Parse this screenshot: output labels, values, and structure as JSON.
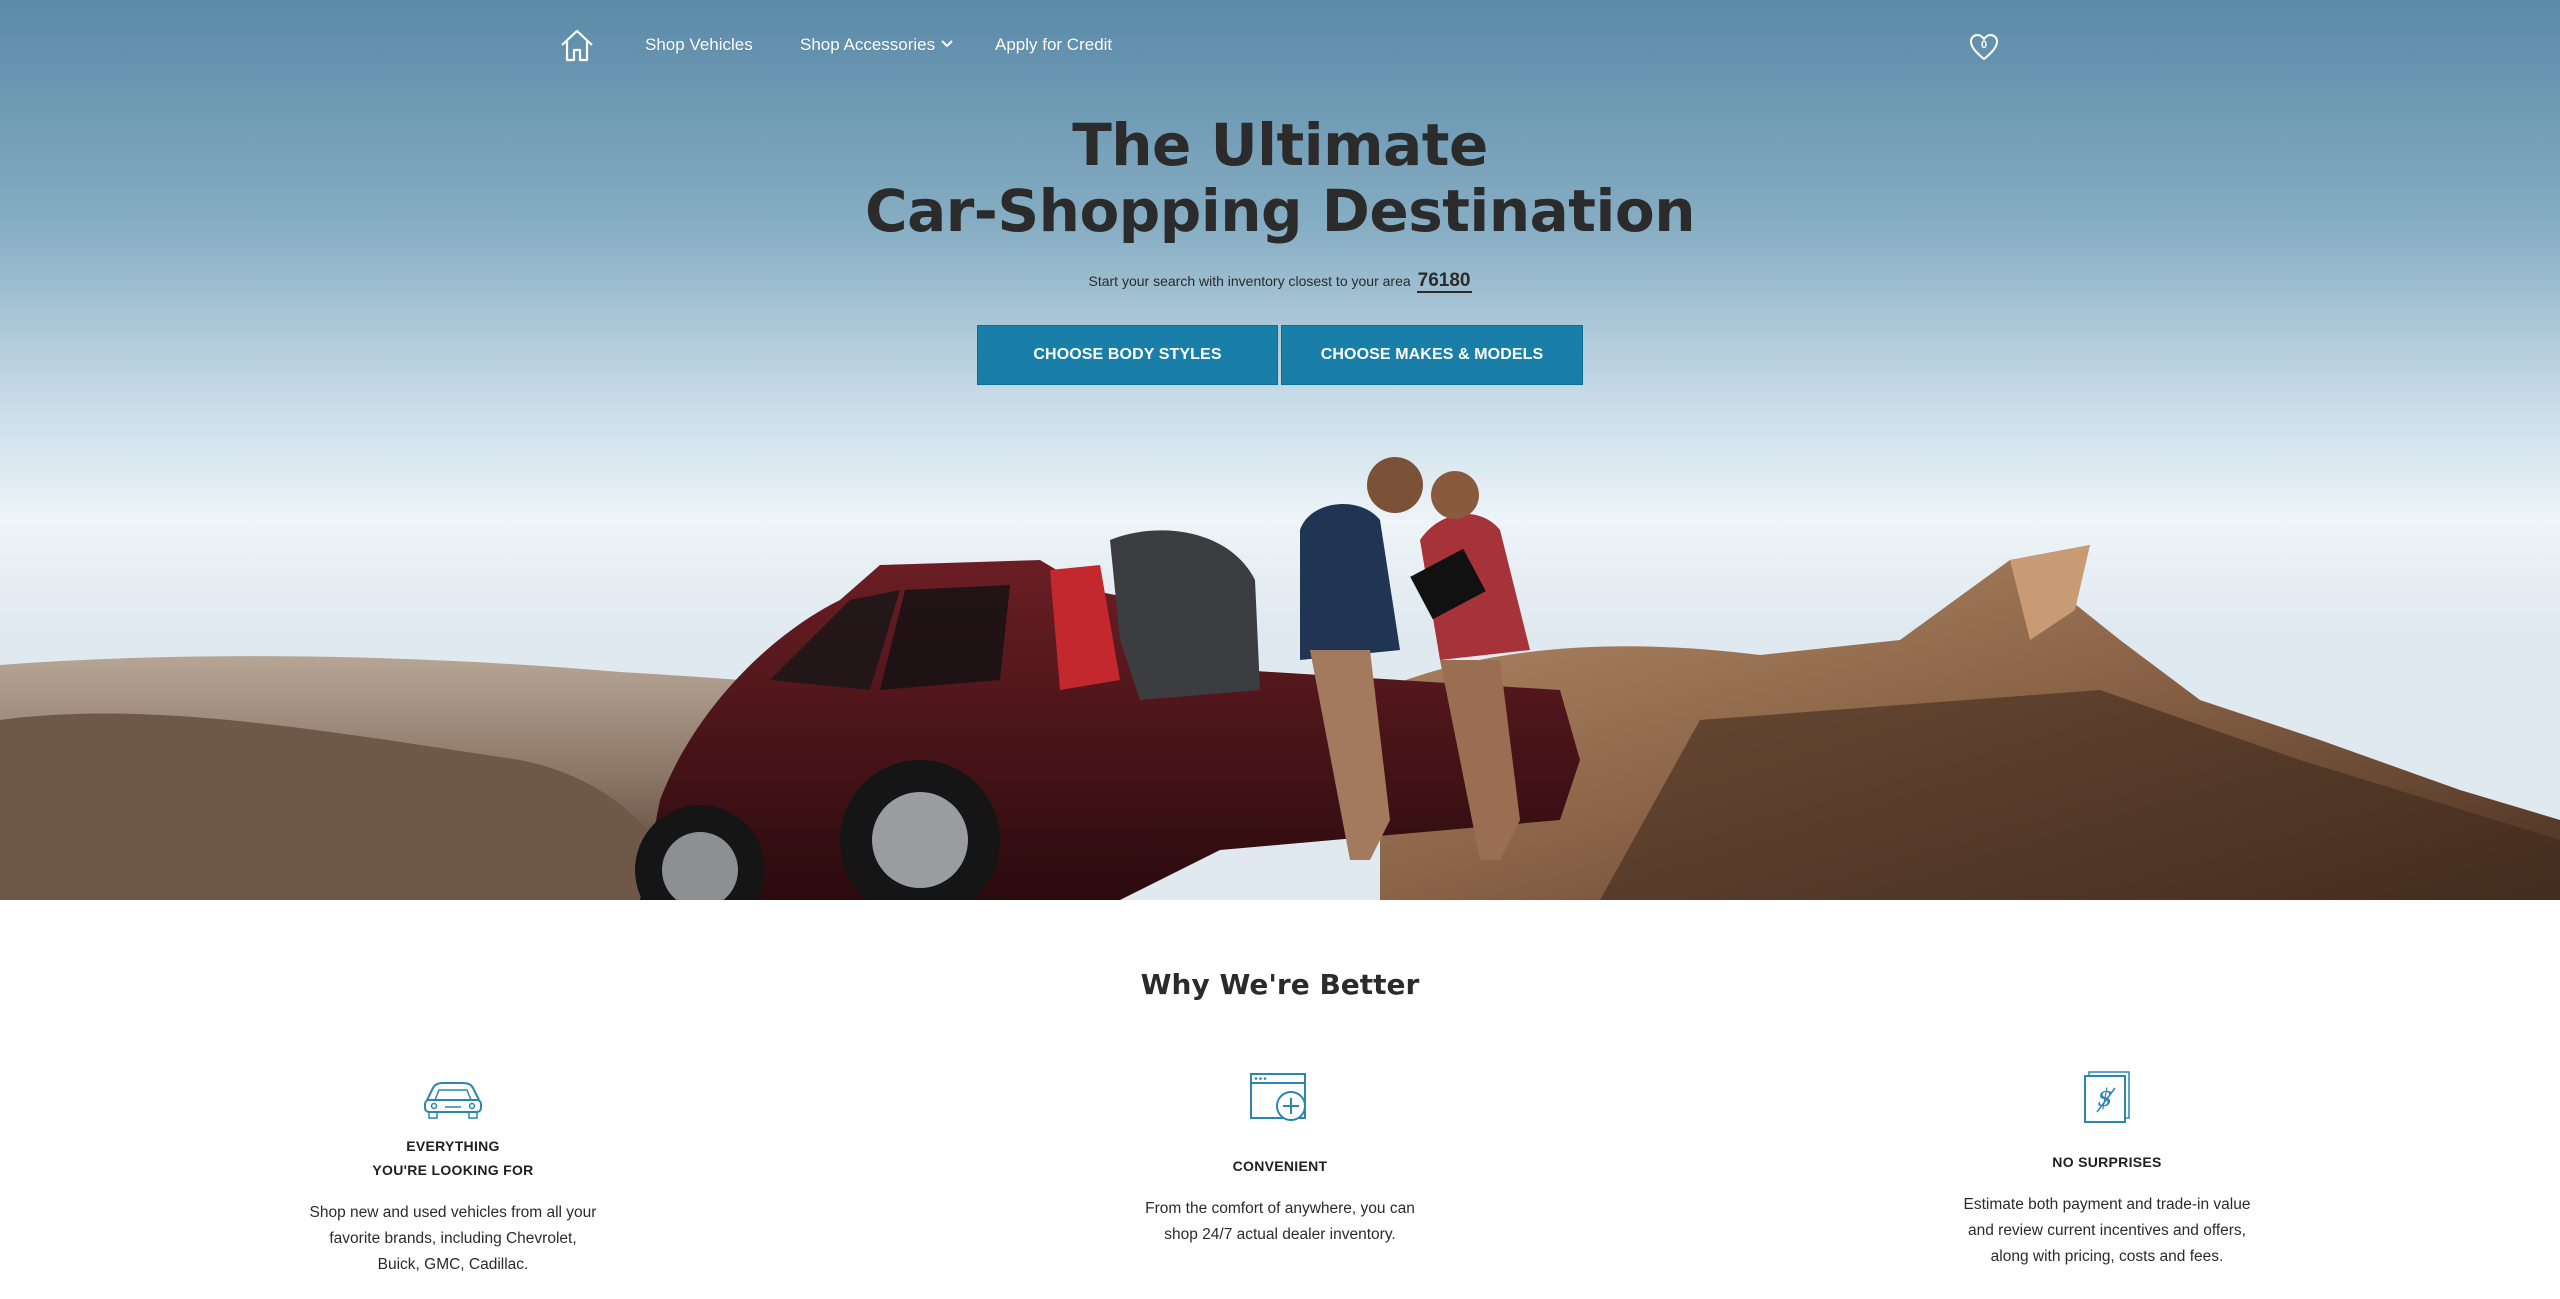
{
  "nav": {
    "items": [
      {
        "label": "Shop Vehicles"
      },
      {
        "label": "Shop Accessories"
      },
      {
        "label": "Apply for Credit"
      }
    ],
    "favorites_count": "0"
  },
  "hero": {
    "headline_line1": "The Ultimate",
    "headline_line2": "Car-Shopping Destination",
    "subline": "Start your search with inventory closest to your area",
    "zip": "76180",
    "buttons": {
      "body_styles": "CHOOSE BODY STYLES",
      "makes_models": "CHOOSE MAKES & MODELS"
    }
  },
  "why": {
    "title": "Why We're Better",
    "features": [
      {
        "icon": "car-icon",
        "title_line1": "EVERYTHING",
        "title_line2": "YOU'RE LOOKING FOR",
        "desc_line1": "Shop new and used vehicles from all your",
        "desc_line2": "favorite brands, including Chevrolet,",
        "desc_line3": "Buick, GMC, Cadillac."
      },
      {
        "icon": "browser-add-icon",
        "title_line1": "CONVENIENT",
        "desc_line1": "From the comfort of anywhere, you can",
        "desc_line2": "shop 24/7 actual dealer inventory."
      },
      {
        "icon": "dollar-document-icon",
        "title_line1": "NO SURPRISES",
        "desc_line1": "Estimate both payment and trade-in value",
        "desc_line2": "and review current incentives and offers,",
        "desc_line3": "along with pricing, costs and fees."
      }
    ]
  },
  "colors": {
    "cta": "#1a7fa8",
    "icon_accent": "#2a86b0",
    "heading": "#2b2b2b"
  }
}
